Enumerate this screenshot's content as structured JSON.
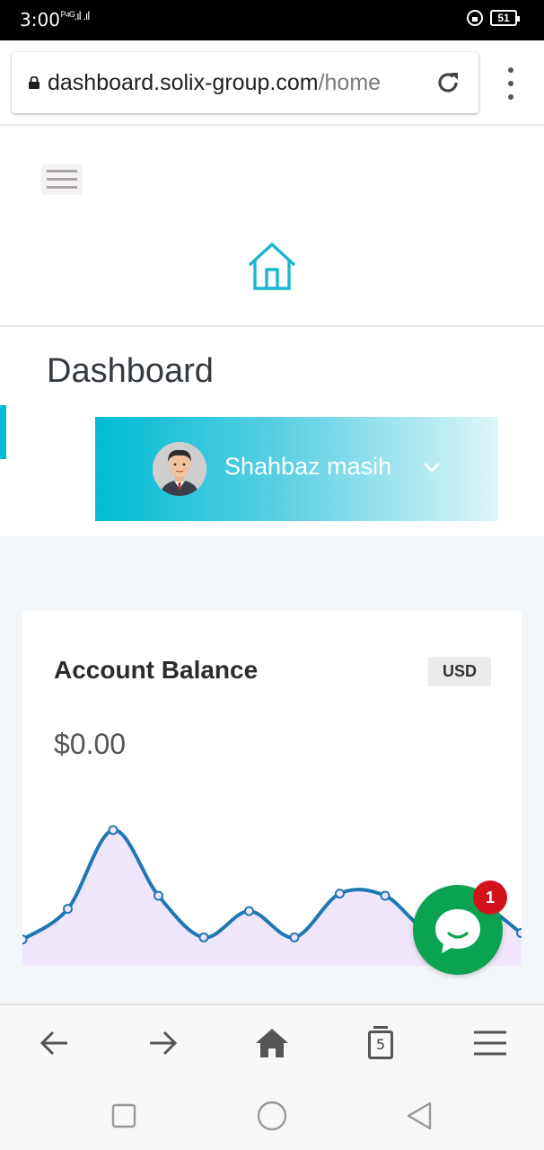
{
  "status_bar": {
    "time": "3:00",
    "signal": "ᴾ⁴ᴳ.ıl .ıl",
    "battery": "51"
  },
  "browser": {
    "url_domain": "dashboard.solix-group.com",
    "url_path": "/home"
  },
  "page": {
    "title": "Dashboard",
    "user_name": "Shahbaz masih"
  },
  "account": {
    "title": "Account Balance",
    "currency": "USD",
    "balance": "$0.00"
  },
  "chat": {
    "badge_count": "1"
  },
  "tabs": {
    "count": "5"
  },
  "colors": {
    "accent": "#00bcd4",
    "chart_line": "#1f77b4",
    "chart_fill": "#efe6fb",
    "chat_green": "#0aa352",
    "badge_red": "#d3131c"
  },
  "chart_data": {
    "type": "area",
    "x": [
      0,
      1,
      2,
      3,
      4,
      5,
      6,
      7,
      8,
      9,
      10,
      11
    ],
    "values": [
      1.2,
      2.6,
      6.2,
      3.2,
      1.3,
      2.5,
      1.3,
      3.3,
      3.2,
      1.6,
      2.8,
      1.5
    ],
    "ylim": [
      0,
      8
    ],
    "grid": false
  }
}
